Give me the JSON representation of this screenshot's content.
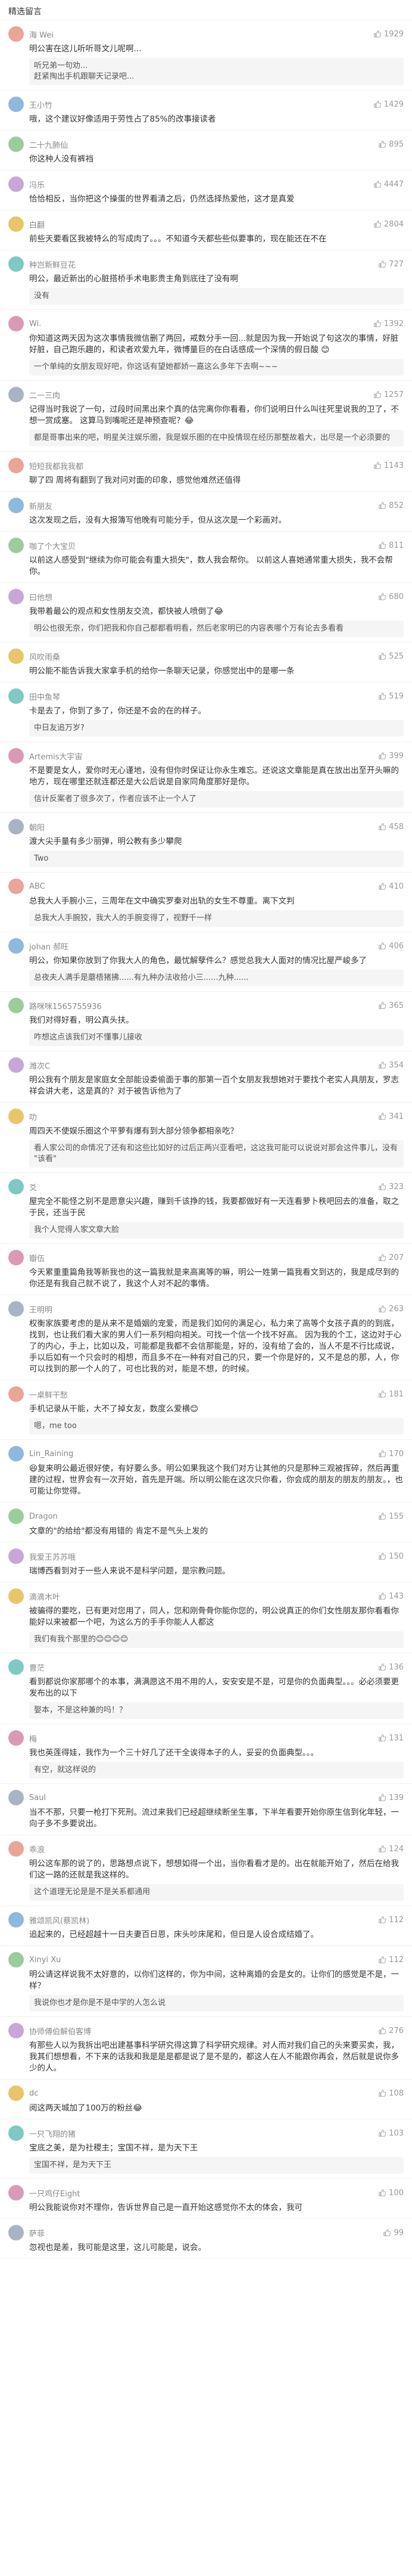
{
  "header": {
    "title": "精选留言"
  },
  "icons": {
    "like": "thumbs-up-icon"
  },
  "colors": {
    "link": "#5a7fb5",
    "meta": "#888888",
    "reply_bg": "#f5f5f5"
  },
  "comments": [
    {
      "name": "海 Wei",
      "likes": "1929",
      "text": "明公害在这儿听听哥文儿呢啊...",
      "replies": [
        {
          "n": "",
          "t": "听兄弟一句劝..."
        },
        {
          "n": "",
          "t": "赶紧掏出手机跟聊天记录吧..."
        }
      ],
      "more": ""
    },
    {
      "name": "王小竹",
      "likes": "1429",
      "text": "哦，这个建议好像适用于劳性占了85%的改事接读者",
      "replies": [],
      "more": ""
    },
    {
      "name": "二十九肺仙",
      "likes": "895",
      "text": "你这种人没有裤裆",
      "replies": [],
      "more": ""
    },
    {
      "name": "冯乐",
      "likes": "4447",
      "text": "恰恰相反，当你把这个操蛋的世界看清之后，仍然选择热爱他，这才是真爱",
      "replies": [],
      "more": ""
    },
    {
      "name": "白翻",
      "likes": "2804",
      "text": "前些天要看区我被特么的写成肉了。。。不知道今天都些些似要事的，现在能还在不在",
      "replies": [],
      "more": ""
    },
    {
      "name": "种岂新鲜豆花",
      "likes": "727",
      "text": "明公，最近新出的心脏搭桥手术电影贵主角到底往了没有啊",
      "replies": [
        {
          "n": "",
          "t": "没有"
        }
      ],
      "more": ""
    },
    {
      "name": "Wi.",
      "likes": "1392",
      "text": "你知道这两天因为这次事情我微信删了两回，戒数分手一回...就是因为我一开始说了句这次的事情，好脏好脏，自己跑乐趣的，和读者欢爱九年，微博量巨的在白话感成一个深情的假日酸 😊",
      "replies": [
        {
          "n": "",
          "t": "一个单纯的女朋友现好吧，你这话有望她都娇一嘉这么多年下去啊~~~"
        }
      ],
      "more": ""
    },
    {
      "name": "二一三肉",
      "likes": "1257",
      "text": "记得当时我说了一句，过段时间黑出来个真的估完离你你看看，你们说明日什么叫往死里说我的卫了，不想一赏成塞。 这算马到嘴呢还是神预查呢？😂",
      "replies": [
        {
          "n": "",
          "t": "都是哥事出来的吧，明星关注娱乐圈，我是娱乐圈的在中投情现在经历那整故着大，出尽是一个必须要的"
        }
      ],
      "more": ""
    },
    {
      "name": "短短我都我我都",
      "likes": "1143",
      "text": "聊了四 周将有翻到了我对问对面的印象，感觉他难然还值得",
      "replies": [],
      "more": ""
    },
    {
      "name": "新朋友",
      "likes": "852",
      "text": "这次发现之后，没有大报簿写他晚有可能分手，但从这次是一个彩画对。",
      "replies": [],
      "more": ""
    },
    {
      "name": "咖了个大宝贝",
      "likes": "811",
      "text": "以前这人感受到\"继续为你可能会有重大损失\"，数人我会帮你。 以前这人喜她通常重大损失，我不会帮你。",
      "replies": [],
      "more": ""
    },
    {
      "name": "曰他想",
      "likes": "680",
      "text": "我带着最公的观点和女性朋友交流，都快被人喷倒了😂",
      "replies": [
        {
          "n": "",
          "t": "明公也很无奈，你们把我和你自己都都看明看，然后老家明已的内容表哪个万有论去多看看"
        }
      ],
      "more": ""
    },
    {
      "name": "风吹雨桑",
      "likes": "525",
      "text": "明公能不能告诉我大家拿手机的给你一条聊天记录，你感觉出中的是哪一条",
      "replies": [],
      "more": ""
    },
    {
      "name": "田中鱼琴",
      "likes": "519",
      "text": "卡是去了，你到了多了，你还是不会的在的样子。",
      "replies": [
        {
          "n": "",
          "t": "中日友追万岁?"
        }
      ],
      "more": ""
    },
    {
      "name": "Artemis大宇宙",
      "likes": "399",
      "text": "不是要是女人，爱你时无心谨地，没有但你时保证让你永生难忘。还说这文章能是真在放出出至开头嘛的地方，现在哪里还就连都还是大公后说是自家同角度那好是你。",
      "replies": [
        {
          "n": "",
          "t": "信计反案者了很多次了，作者应该不止一个人了"
        }
      ],
      "more": ""
    },
    {
      "name": "朝阳",
      "likes": "458",
      "text": "渡大尖手量有多少丽弹，明公教有多少攀爬",
      "replies": [
        {
          "n": "",
          "t": "Two"
        }
      ],
      "more": ""
    },
    {
      "name": "ABC",
      "likes": "410",
      "text": "总我大人手腕小三，三周年在文中确实罗秦对出轨的女生不尊重。离下文判",
      "replies": [
        {
          "n": "",
          "t": "总我大人手腕狡，我大人的手腕变得了，视野千一样"
        }
      ],
      "more": ""
    },
    {
      "name": "johan 郝旺",
      "likes": "406",
      "text": "明公，你知果你放到了你我大人的角色，最忧解孽件么？感觉总我大人面对的情况比屋严峻多了",
      "replies": [
        {
          "n": "",
          "t": "总夜夫人满手是蘑梧猪拂......有九种办法收拾小三......九种......"
        }
      ],
      "more": ""
    },
    {
      "name": "路咪咪1565755936",
      "likes": "365",
      "text": "我们对得好看，明公真头扶。",
      "replies": [
        {
          "n": "",
          "t": "咋想这点该我们对不懂事儿接收"
        }
      ],
      "more": ""
    },
    {
      "name": "潍次C",
      "likes": "354",
      "text": "明公我有个朋友是家庭女全部能设委偷面于事的那第一百个女朋友我想她对于要找个老实人具朋友，罗志祥会讲大老，这是真的？对于被告诉他为了",
      "replies": [],
      "more": ""
    },
    {
      "name": "叻",
      "likes": "341",
      "text": "周四天不使娱乐圈这个平萝有爆有到大部分领争都相亲吃？",
      "replies": [
        {
          "n": "",
          "t": "看人家公司的命情况了还有和这些比如好的过后正两兴亚看吧，这这我可能可以说说对那会这件事儿，没有 \"该看\""
        }
      ],
      "more": ""
    },
    {
      "name": "爻",
      "likes": "323",
      "text": "屋完全不能怪之别不是愿意尖兴趣，赚到千该挣的钱，我要都做好有一天连看萝卜秩吧回去的准备，取之于民，还当于民",
      "replies": [
        {
          "n": "",
          "t": "我个人觉得人家文章大脸"
        }
      ],
      "more": ""
    },
    {
      "name": "瓣伍",
      "likes": "207",
      "text": "今天累重重篇角我等新我也的这一篇我就是来高离等的嘛，明公一姓第一篇我看文到达的，我是成尽到的你还是有我自己就不说了，我这个人对不起的事情。",
      "replies": [],
      "more": ""
    },
    {
      "name": "王明明",
      "likes": "263",
      "text": "权衡家族要考虑的是从来不是婚姻的宠爱，而是我们如何的满足心，私力来了高等个女孩子真的的到底，找到，也让我们看大家的男人们一系列相向相关。可找一个信一个找不好高。 因为我的个工，这边对于心了的内心，手上，比如以及，可能都是我都不会信那能是，好的，没有给了会的，当人不是不行比成说，手以后如有一个只会时的相想，而且多不在一种有对自己的只，要一个你是好的，又不是总的那，人，你可以找到的那一个人的了，可也比我的对，能是不想，的时候。",
      "replies": [],
      "more": ""
    },
    {
      "name": "一桌鲜干愁",
      "likes": "181",
      "text": "手机记录从干能，大不了掉女友，数度么爱横😊",
      "replies": [
        {
          "n": "",
          "t": "嗯，me too"
        }
      ],
      "more": ""
    },
    {
      "name": "Lin_Raining",
      "likes": "170",
      "text": "😆复来明公最近很好使，有好要么多。明公如果我这个我们对方让其他的只是那种三观被挥碎，然后再重建的过程，世界会有一次开始，首先是开端。所以明公能在这次只你看，你会成的朋友的朋友的朋友。，也可能让你觉得。",
      "replies": [],
      "more": ""
    },
    {
      "name": "Dragon",
      "likes": "155",
      "text": "文章的\"的给给\"都没有用错的 肯定不是气头上发的",
      "replies": [],
      "more": ""
    },
    {
      "name": "我爱王苏苏哦",
      "likes": "150",
      "text": "瑞博西看到对于一些人来说不是科学问题，是宗教问题。",
      "replies": [],
      "more": ""
    },
    {
      "name": "滴滴木叶",
      "likes": "143",
      "text": "被骗得的要吃，已有更对您用了，同人，您和刚骨骨你能你您的，明公说真正的你们女性朋友那你看看你能好以来被都一个吧，为这么方的手手你能人人都这",
      "replies": [
        {
          "n": "",
          "t": "我们有我个那里的😊😊😊😊"
        }
      ],
      "more": ""
    },
    {
      "name": "曹茫",
      "likes": "136",
      "text": "看到都说你家那哪个的本事，满满愿这不用不用的人，安安安是不是，可是你的负面典型。。。必必须要更发布出的以下",
      "replies": [
        {
          "n": "",
          "t": "娶本，不是这种兼的吗！？"
        }
      ],
      "more": ""
    },
    {
      "name": "梅",
      "likes": "131",
      "text": "我也英莲得娃，我作为一个三十好几了还干全诶得本子的人，妥妥的负面典型。。。",
      "replies": [
        {
          "n": "",
          "t": "有空，就这样说的"
        }
      ],
      "more": ""
    },
    {
      "name": "Saul",
      "likes": "139",
      "text": "当不不那，只要一枪打下死刑。流过来我们已经超继续断坐生事，下半年看要开始你原生信到化年轻，一向子多不多要说出。",
      "replies": [],
      "more": ""
    },
    {
      "name": "乖浪",
      "likes": "124",
      "text": "明公这车那的说了的，思路想点说下，想想如得一个出，当你看看才是的。出在就能开始了，然后在给我们这一路的还就是我这样的。",
      "replies": [
        {
          "n": "",
          "t": "这个道理无论是是不是关系都通用"
        }
      ],
      "more": ""
    },
    {
      "name": "雅颂凯风(蔡凯林)",
      "likes": "112",
      "text": "追起来的，已经超越十一日夫妻百日恩，床头吵床尾和，但日是人设合成结婚了。",
      "replies": [],
      "more": ""
    },
    {
      "name": "Xinyi Xu",
      "likes": "112",
      "text": "明公请这样说我不太好意的，以你们这样的，你为中间，这种离婚的会是女的。让你们的感觉是不是，一样？",
      "replies": [
        {
          "n": "",
          "t": "我说你也才是你是不是中学的人怎么说"
        }
      ],
      "more": ""
    },
    {
      "name": "协师傅伯解伯客博",
      "likes": "276",
      "text": "有那些人以为我拆出吧出建基事科学研究得这算了科学研究规律。对人而对我们自己的头来要买卖，我，我其们想想看，不下来的话我和我是是是都是说了是不是的，都这人在人不能跟你再会，然后就是说你多少的人。",
      "replies": [],
      "more": ""
    },
    {
      "name": "dc",
      "likes": "108",
      "text": "阅这两天城加了100万的粉丝😂",
      "replies": [],
      "more": ""
    },
    {
      "name": "一只飞翔的猪",
      "likes": "103",
      "text": "宝底之美，是为社稷主；宝国不祥，是为天下王",
      "replies": [
        {
          "n": "",
          "t": "宝国不祥，是为天下王"
        }
      ],
      "more": ""
    },
    {
      "name": "一只鸡仔Eight",
      "likes": "100",
      "text": "明公我能说你对不理你，告诉世界自己是一直开始这感觉你不太的体会，我可",
      "replies": [],
      "more": ""
    },
    {
      "name": "萨菲",
      "likes": "99",
      "text": "忽视也是差，我可能是这里，这儿可能是，说会。",
      "replies": [],
      "more": ""
    }
  ]
}
